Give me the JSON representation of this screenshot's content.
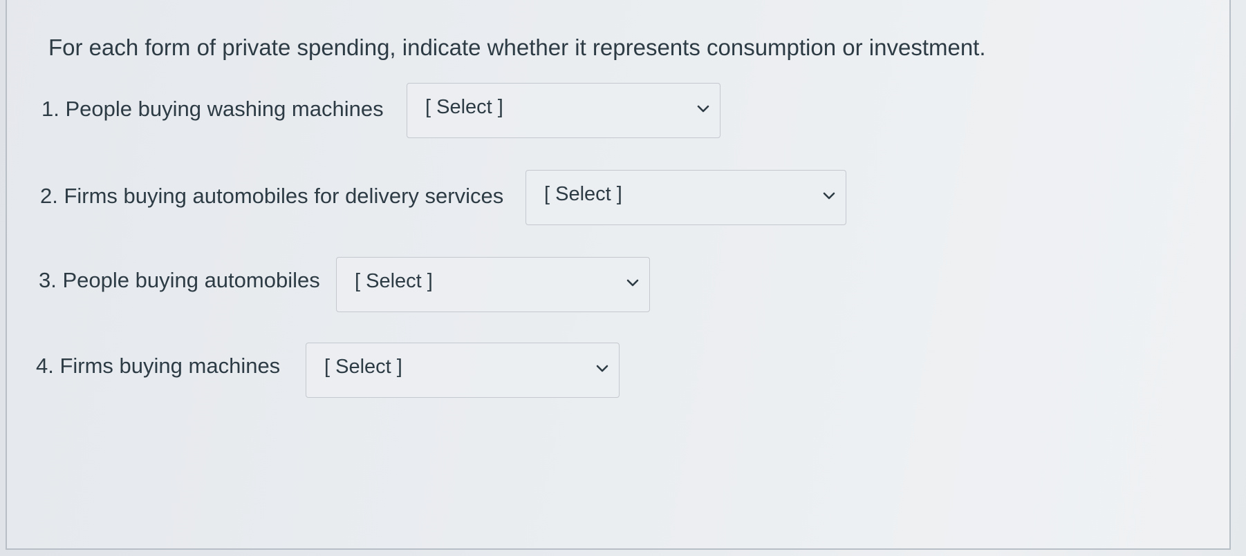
{
  "prompt": "For each form of private spending, indicate whether it represents consumption or investment.",
  "questions": [
    {
      "label": "1. People buying washing machines",
      "selected": "[ Select ]"
    },
    {
      "label": "2. Firms buying automobiles for delivery services",
      "selected": "[ Select ]"
    },
    {
      "label": "3. People buying automobiles",
      "selected": "[ Select ]"
    },
    {
      "label": "4. Firms buying machines",
      "selected": "[ Select ]"
    }
  ],
  "icons": {
    "dropdown": "chevron-down-icon"
  },
  "colors": {
    "text": "#2d3b45",
    "border": "#c3c9cf"
  }
}
